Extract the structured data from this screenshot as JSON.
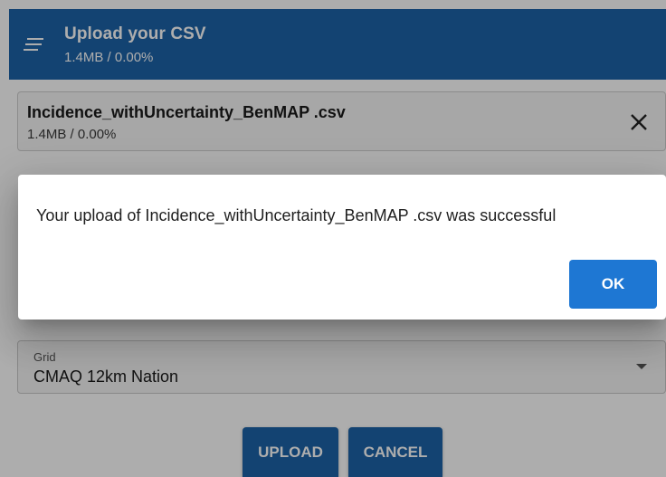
{
  "header": {
    "title": "Upload your CSV",
    "subtitle": "1.4MB / 0.00%",
    "menu_icon": "menu-lines-icon",
    "background": "#1c63a8"
  },
  "file_card": {
    "name": "Incidence_withUncertainty_BenMAP .csv",
    "size": "1.4MB / 0.00%",
    "close_icon": "close-icon"
  },
  "grid_field": {
    "label": "Grid",
    "value": "CMAQ 12km Nation",
    "dropdown_icon": "dropdown-arrow-icon"
  },
  "actions": {
    "upload_label": "UPLOAD",
    "cancel_label": "CANCEL"
  },
  "dialog": {
    "message": "Your upload of Incidence_withUncertainty_BenMAP .csv was successful",
    "ok_label": "OK",
    "ok_color": "#1e77d3"
  }
}
